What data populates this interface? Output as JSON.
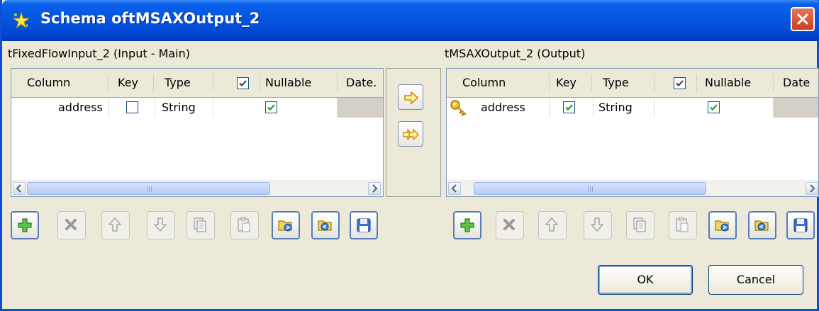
{
  "window": {
    "title": "Schema oftMSAXOutput_2",
    "icon": "star-sparkle-icon",
    "close_icon": "close-icon",
    "title_color": "#0454e0",
    "close_color": "#c9401f"
  },
  "left_pane": {
    "label": "tFixedFlowInput_2 (Input - Main)",
    "columns": [
      "Column",
      "Key",
      "Type",
      "",
      "Nullable",
      "Date."
    ],
    "header_checkbox_checked": true,
    "rows": [
      {
        "column": "address",
        "key": false,
        "type": "String",
        "nullable": true
      }
    ]
  },
  "right_pane": {
    "label": "tMSAXOutput_2 (Output)",
    "columns": [
      "Column",
      "Key",
      "Type",
      "",
      "Nullable",
      "Date"
    ],
    "header_checkbox_checked": true,
    "rows": [
      {
        "column": "address",
        "key": true,
        "type": "String",
        "nullable": true,
        "row_icon": "key-icon"
      }
    ]
  },
  "copy_buttons": [
    {
      "name": "copy-selected-button",
      "icon": "arrow-right-icon"
    },
    {
      "name": "copy-all-button",
      "icon": "double-arrow-right-icon"
    }
  ],
  "toolbar": {
    "buttons": [
      {
        "icon": "add-icon",
        "enabled": true
      },
      {
        "icon": "delete-icon",
        "enabled": false
      },
      {
        "icon": "move-up-icon",
        "enabled": false
      },
      {
        "icon": "move-down-icon",
        "enabled": false
      },
      {
        "icon": "copy-icon",
        "enabled": false
      },
      {
        "icon": "paste-icon",
        "enabled": false
      },
      {
        "icon": "import-icon",
        "enabled": true
      },
      {
        "icon": "export-icon",
        "enabled": true
      },
      {
        "icon": "save-icon",
        "enabled": true
      }
    ]
  },
  "footer": {
    "ok_label": "OK",
    "cancel_label": "Cancel"
  },
  "colors": {
    "dialog_bg": "#ece9d8",
    "checkmark": "#21a121",
    "selection_blue": "#0454e0"
  }
}
